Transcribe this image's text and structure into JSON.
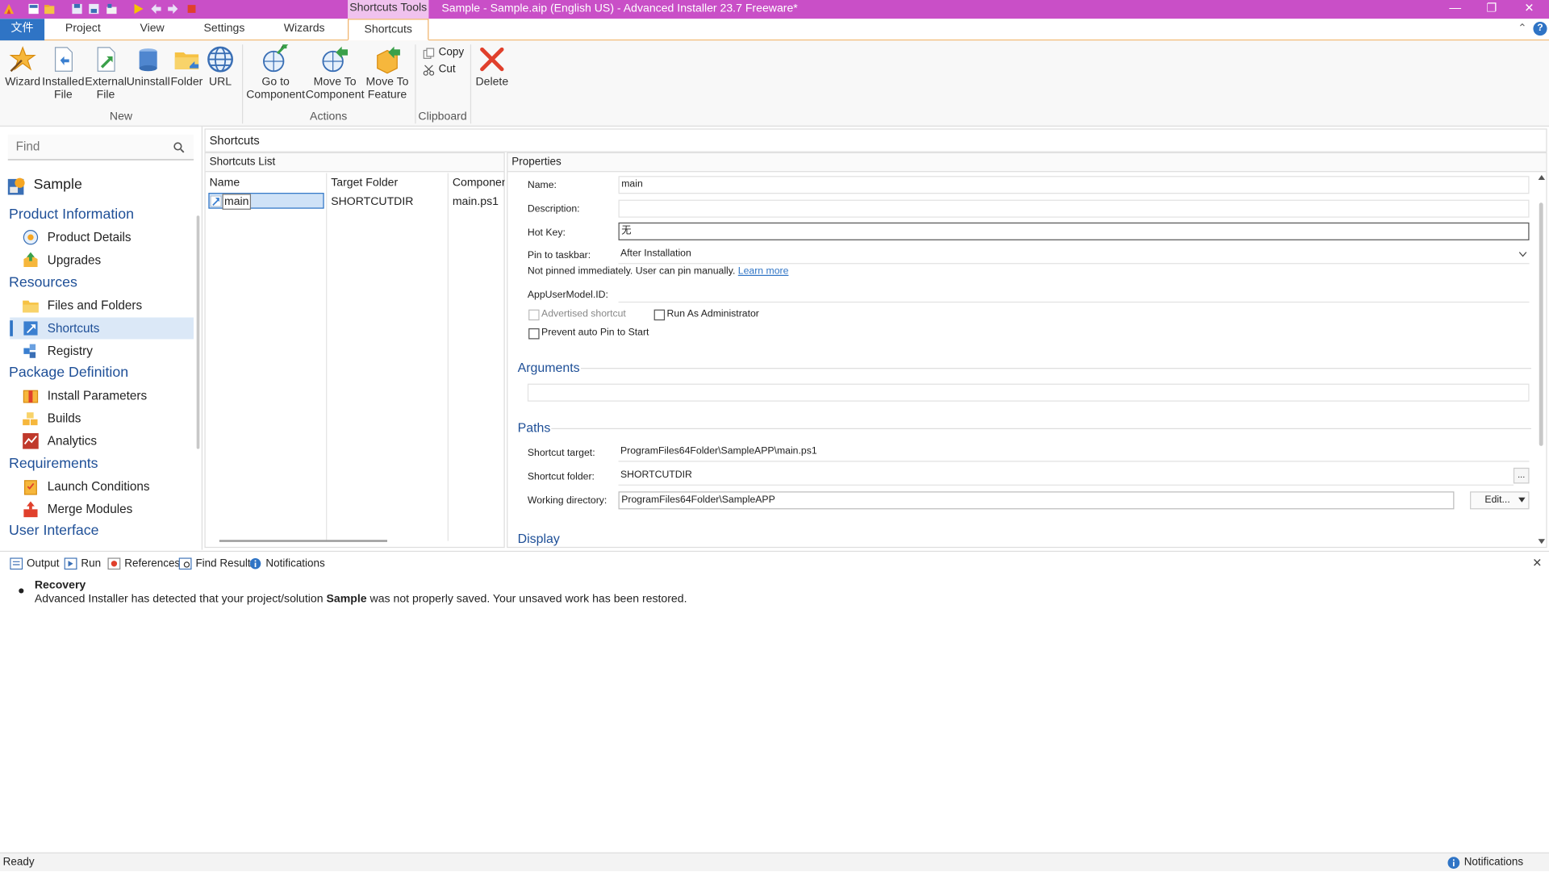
{
  "titlebar": {
    "title": "Sample - Sample.aip (English US) - Advanced Installer 23.7 Freeware*",
    "context_tab": "Shortcuts Tools",
    "minimize": "—",
    "restore": "❐",
    "close": "✕"
  },
  "tabs": {
    "file": "文件",
    "items": [
      "Project",
      "View",
      "Settings",
      "Wizards",
      "Shortcuts"
    ],
    "collapse_glyph": "⌃",
    "help_glyph": "?"
  },
  "ribbon": {
    "new_group": "New",
    "actions_group": "Actions",
    "clipboard_group": "Clipboard",
    "wizard": "Wizard",
    "installed_file_1": "Installed",
    "installed_file_2": "File",
    "external_file_1": "External",
    "external_file_2": "File",
    "uninstall": "Uninstall",
    "folder": "Folder",
    "url": "URL",
    "go_to_component_1": "Go to",
    "go_to_component_2": "Component",
    "move_to_component_1": "Move To",
    "move_to_component_2": "Component",
    "move_to_feature_1": "Move To",
    "move_to_feature_2": "Feature",
    "copy": "Copy",
    "cut": "Cut",
    "delete": "Delete"
  },
  "sidebar": {
    "search_placeholder": "Find",
    "project_name": "Sample",
    "sections": {
      "product_information": "Product Information",
      "resources": "Resources",
      "package_definition": "Package Definition",
      "requirements": "Requirements",
      "user_interface": "User Interface"
    },
    "items": {
      "product_details": "Product Details",
      "upgrades": "Upgrades",
      "files_and_folders": "Files and Folders",
      "shortcuts": "Shortcuts",
      "registry": "Registry",
      "install_parameters": "Install Parameters",
      "builds": "Builds",
      "analytics": "Analytics",
      "launch_conditions": "Launch Conditions",
      "merge_modules": "Merge Modules"
    }
  },
  "main": {
    "panel_title": "Shortcuts",
    "list": {
      "header": "Shortcuts List",
      "columns": [
        "Name",
        "Target Folder",
        "Componen"
      ],
      "rows": [
        {
          "name": "main",
          "target_folder": "SHORTCUTDIR",
          "component": "main.ps1"
        }
      ]
    },
    "properties": {
      "header": "Properties",
      "name_label": "Name:",
      "name_value": "main",
      "description_label": "Description:",
      "description_value": "",
      "hotkey_label": "Hot Key:",
      "hotkey_value": "无",
      "pin_label": "Pin to taskbar:",
      "pin_value": "After Installation",
      "pin_note": "Not pinned immediately. User can pin manually.",
      "learn_more": "Learn more",
      "appusermodel_label": "AppUserModel.ID:",
      "appusermodel_value": "",
      "advertised_label": "Advertised shortcut",
      "run_as_admin_label": "Run As Administrator",
      "prevent_pin_label": "Prevent auto Pin to Start",
      "arguments_section": "Arguments",
      "arguments_value": "",
      "paths_section": "Paths",
      "shortcut_target_label": "Shortcut target:",
      "shortcut_target_value": "ProgramFiles64Folder\\SampleAPP\\main.ps1",
      "shortcut_folder_label": "Shortcut folder:",
      "shortcut_folder_value": "SHORTCUTDIR",
      "browse_button": "...",
      "working_dir_label": "Working directory:",
      "working_dir_value": "ProgramFiles64Folder\\SampleAPP",
      "edit_button": "Edit...",
      "display_section": "Display"
    }
  },
  "bottom": {
    "tabs": [
      "Output",
      "Run",
      "References",
      "Find Result",
      "Notifications"
    ],
    "close_glyph": "✕",
    "notification": {
      "title": "Recovery",
      "text_before": "Advanced Installer has detected that your project/solution ",
      "project": "Sample",
      "text_after": " was not properly saved. Your unsaved work has been restored."
    }
  },
  "statusbar": {
    "status": "Ready",
    "notifications": "Notifications"
  },
  "colors": {
    "titlebar": "#c94fc7",
    "accent": "#2f74c5",
    "section_heading": "#1e4f97",
    "ribbon_tab_border": "#f0b36a"
  }
}
